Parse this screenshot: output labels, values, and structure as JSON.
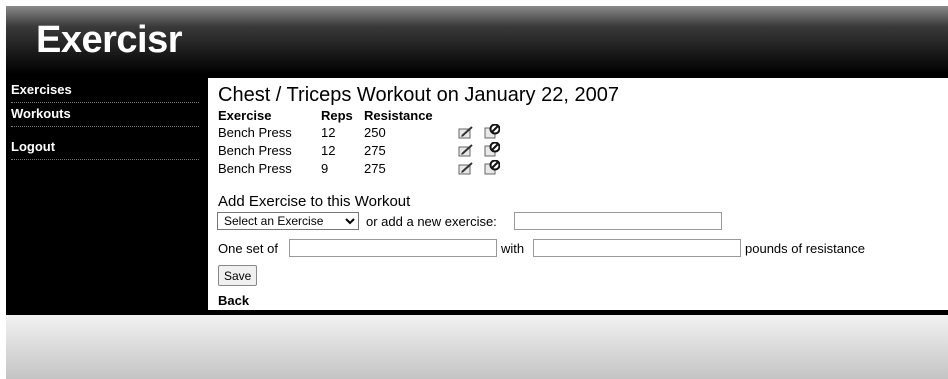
{
  "app": {
    "logo": "Exercisr"
  },
  "sidebar": {
    "items": [
      {
        "label": "Exercises"
      },
      {
        "label": "Workouts"
      },
      {
        "label": "Logout"
      }
    ]
  },
  "workout": {
    "title": "Chest / Triceps Workout on January 22, 2007",
    "columns": [
      "Exercise",
      "Reps",
      "Resistance"
    ],
    "rows": [
      {
        "exercise": "Bench Press",
        "reps": "12",
        "resistance": "250"
      },
      {
        "exercise": "Bench Press",
        "reps": "12",
        "resistance": "275"
      },
      {
        "exercise": "Bench Press",
        "reps": "9",
        "resistance": "275"
      }
    ],
    "row_icons": [
      "edit-icon",
      "delete-icon"
    ]
  },
  "add_form": {
    "heading": "Add Exercise to this Workout",
    "select_value": "Select an Exercise",
    "or_label": "or add a new exercise:",
    "new_exercise_value": "",
    "one_set_label": "One set of",
    "reps_value": "",
    "with_label": "with",
    "resistance_value": "",
    "pounds_label": "pounds of resistance",
    "save_label": "Save"
  },
  "back_label": "Back"
}
